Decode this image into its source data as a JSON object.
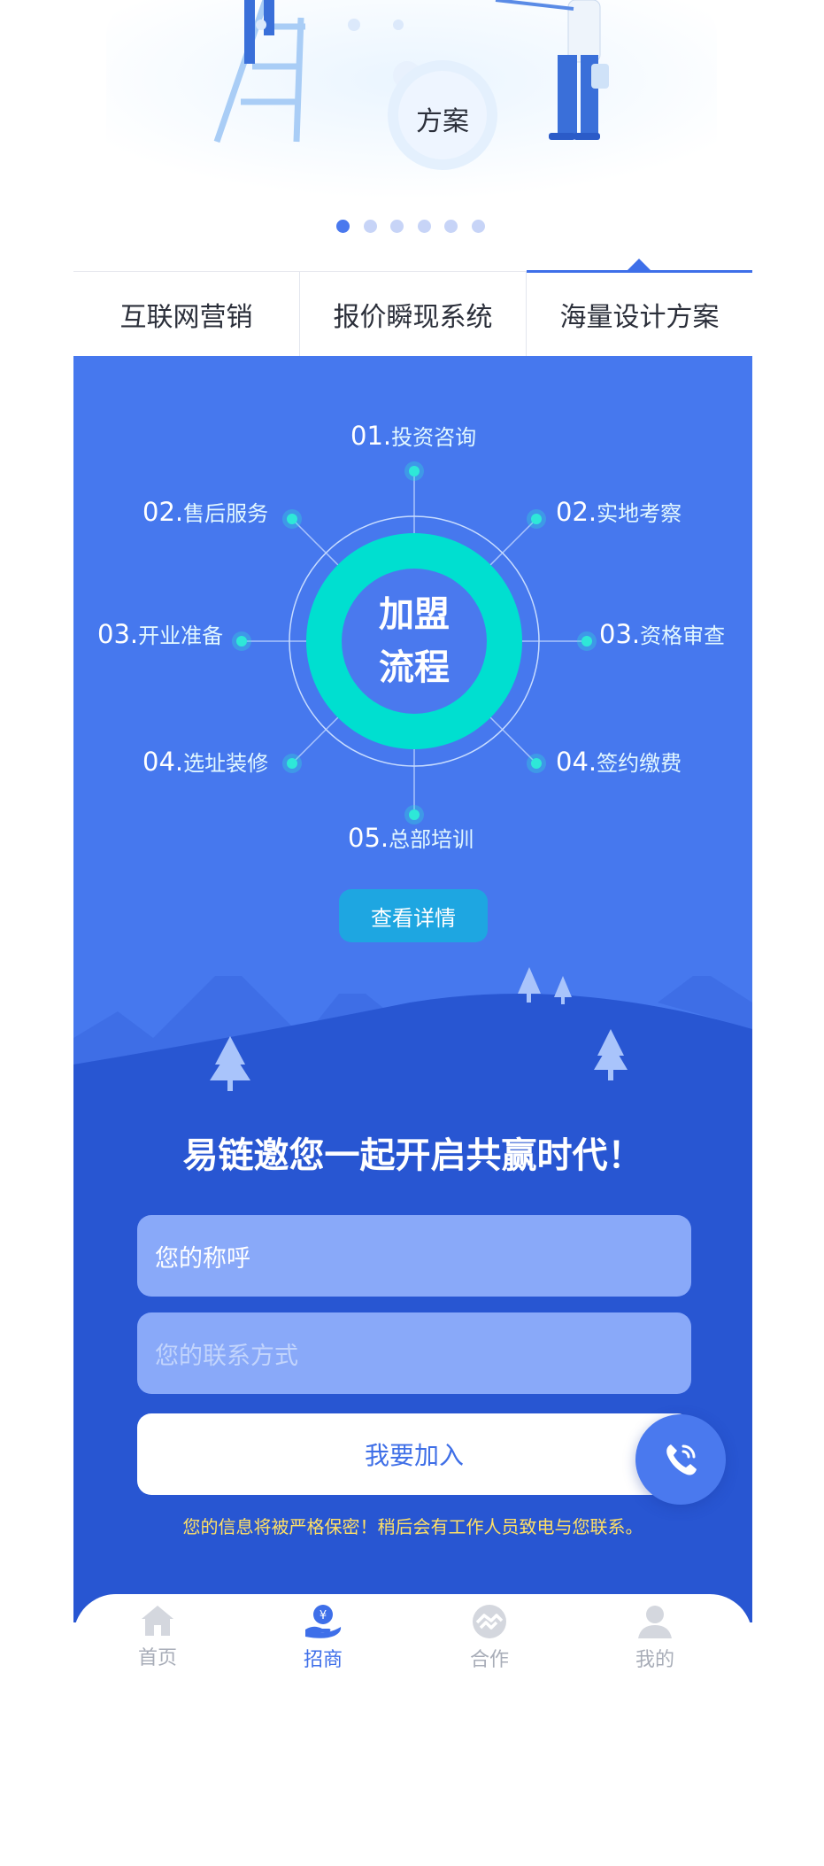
{
  "banner": {
    "caption": "方案",
    "dots": [
      true,
      false,
      false,
      false,
      false,
      false
    ]
  },
  "tabs": [
    {
      "label": "互联网营销",
      "active": false
    },
    {
      "label": "报价瞬现系统",
      "active": false
    },
    {
      "label": "海量设计方案",
      "active": true
    }
  ],
  "process": {
    "center_line1": "加盟",
    "center_line2": "流程",
    "nodes": [
      {
        "num": "01.",
        "text": "投资咨询"
      },
      {
        "num": "02.",
        "text": "实地考察"
      },
      {
        "num": "03.",
        "text": "资格审查"
      },
      {
        "num": "04.",
        "text": "签约缴费"
      },
      {
        "num": "05.",
        "text": "总部培训"
      },
      {
        "num": "04.",
        "text": "选址装修"
      },
      {
        "num": "03.",
        "text": "开业准备"
      },
      {
        "num": "02.",
        "text": "售后服务"
      }
    ],
    "detail_button": "查看详情"
  },
  "form": {
    "title": "易链邀您一起开启共赢时代！",
    "name_value": "您的称呼",
    "contact_placeholder": "您的联系方式",
    "submit_label": "我要加入",
    "privacy_note": "您的信息将被严格保密！稍后会有工作人员致电与您联系。"
  },
  "nav": [
    {
      "label": "首页",
      "icon": "home-icon",
      "active": false
    },
    {
      "label": "招商",
      "icon": "yen-hand-icon",
      "active": true
    },
    {
      "label": "合作",
      "icon": "handshake-icon",
      "active": false
    },
    {
      "label": "我的",
      "icon": "user-icon",
      "active": false
    }
  ],
  "colors": {
    "primary": "#4678ee",
    "accent_teal": "#00e0cf",
    "dark_blue": "#2856d2",
    "note_yellow": "#ffe066"
  }
}
